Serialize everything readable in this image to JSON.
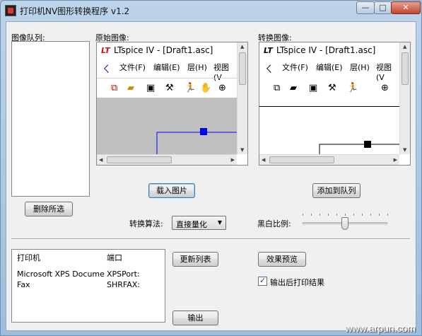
{
  "window": {
    "title": "打印机NV图形转换程序 v1.2",
    "controls": {
      "minimize": "—",
      "maximize": "□",
      "close": "✕"
    }
  },
  "queue": {
    "label": "图像队列:",
    "delete_button": "删除所选"
  },
  "original": {
    "label": "原始图像:",
    "logo": "LT",
    "app_title": "LTspice IV - [Draft1.asc]",
    "menu": [
      "文件(F)",
      "编辑(E)",
      "层(H)",
      "视图(V"
    ],
    "load_button": "载入图片"
  },
  "converted": {
    "label": "转换图像:",
    "logo": "LT",
    "app_title": "LTspice IV - [Draft1.asc]",
    "menu": [
      "文件(F)",
      "编辑(E)",
      "层(H)",
      "视图(V"
    ],
    "add_button": "添加到队列"
  },
  "algorithm": {
    "label": "转换算法:",
    "selected": "直接量化"
  },
  "threshold": {
    "label": "黑白比例:",
    "value_fraction": 0.5
  },
  "printers": {
    "columns": [
      "打印机",
      "端口"
    ],
    "rows": [
      {
        "name": "Microsoft XPS Document ...",
        "port": "XPSPort:"
      },
      {
        "name": "Fax",
        "port": "SHRFAX:"
      }
    ],
    "refresh_button": "更新列表",
    "output_button": "输出"
  },
  "preview_button": "效果预览",
  "print_after": {
    "label": "输出后打印结果",
    "checked": true
  },
  "watermark": "www.arpun.com",
  "colors": {
    "accent": "#0000ff",
    "canvas_gray": "#c0c0c0",
    "logo_red": "#cc1111"
  }
}
